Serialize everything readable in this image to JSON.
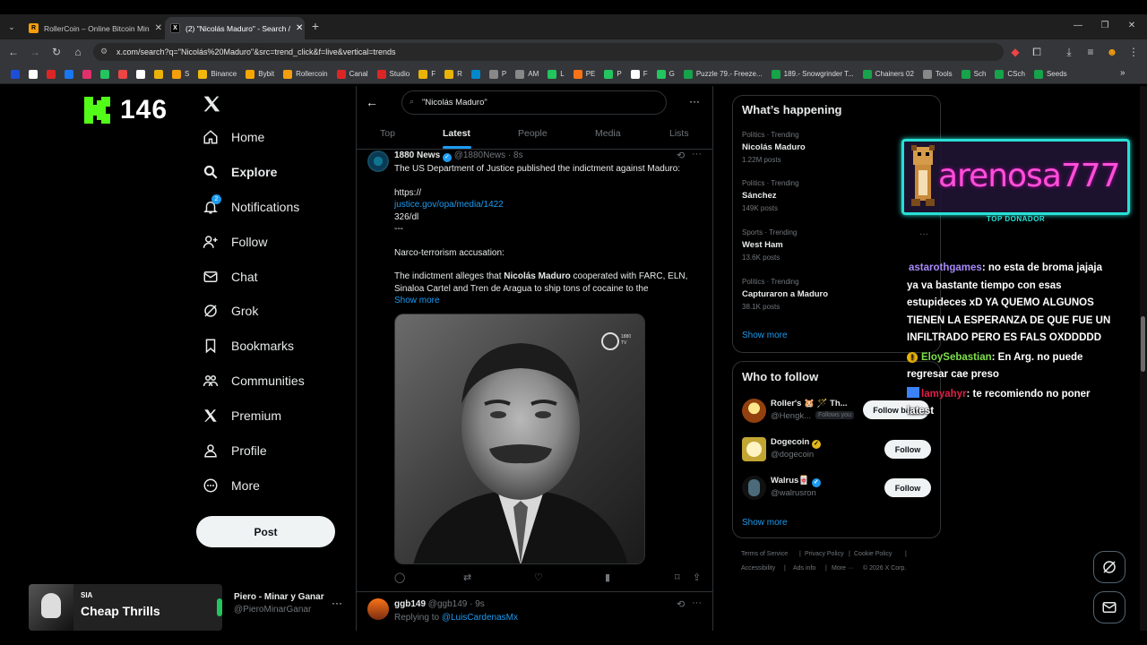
{
  "browser": {
    "tabs": [
      {
        "title": "RollerCoin – Online Bitcoin Min"
      },
      {
        "title": "(2) \"Nicolás Maduro\" - Search /"
      }
    ],
    "new_tab_symbol": "+",
    "url": "x.com/search?q=\"Nicolás%20Maduro\"&src=trend_click&f=live&vertical=trends",
    "bookmarks": [
      "",
      "",
      "",
      "",
      "",
      "",
      "",
      "",
      "",
      "S",
      "Binance",
      "Bybit",
      "Rollercoin",
      "Canal",
      "Studio",
      "F",
      "R",
      "",
      "P",
      "AM",
      "L",
      "PE",
      "P",
      "F",
      "G",
      "Puzzle 79.- Freeze...",
      "189.- Snowgrinder T...",
      "Chainers 02",
      "Tools",
      "Sch",
      "CSch",
      "Seeds"
    ]
  },
  "overlay": {
    "kick_count": "146",
    "donor_name": "arenosa777",
    "donor_label": "TOP DONADOR",
    "now_playing_artist": "SIA",
    "now_playing_title": "Cheap Thrills",
    "chat": [
      {
        "user": "astarothgames",
        "text": ": no esta de broma jajaja ya va bastante tiempo con esas estupideces xD YA QUEMO ALGUNOS TIENEN LA ESPERANZA DE QUE FUE UN INFILTRADO PERO ES FALS OXDDDDD",
        "color": "#a78bfa"
      },
      {
        "user": "EloySebastian",
        "text": ": En Arg. no puede regresar cae preso",
        "color": "#7ee04b"
      },
      {
        "user": "lamyahyr",
        "text": ": te recomiendo no poner latest",
        "color": "#e11d48"
      }
    ]
  },
  "nav": {
    "items": [
      {
        "label": "Home",
        "icon": "home-icon"
      },
      {
        "label": "Explore",
        "icon": "search-icon"
      },
      {
        "label": "Notifications",
        "icon": "bell-icon",
        "badge": "2"
      },
      {
        "label": "Follow",
        "icon": "person-add-icon"
      },
      {
        "label": "Chat",
        "icon": "mail-icon"
      },
      {
        "label": "Grok",
        "icon": "grok-icon"
      },
      {
        "label": "Bookmarks",
        "icon": "bookmark-icon"
      },
      {
        "label": "Communities",
        "icon": "people-icon"
      },
      {
        "label": "Premium",
        "icon": "x-logo-icon"
      },
      {
        "label": "Profile",
        "icon": "person-icon"
      },
      {
        "label": "More",
        "icon": "more-circle-icon"
      }
    ],
    "post_label": "Post",
    "account_name": "Piero - Minar y Ganar",
    "account_handle": "@PieroMinarGanar"
  },
  "search": {
    "query": "\"Nicolás Maduro\"",
    "tabs": [
      "Top",
      "Latest",
      "People",
      "Media",
      "Lists"
    ],
    "active_tab": "Latest"
  },
  "tweet1": {
    "name": "1880 News",
    "handle": "@1880News",
    "time": "· 8s",
    "line1": "The US Department of Justice published the indictment against Maduro:",
    "url_prefix": "https://",
    "url_link": "justice.gov/opa/media/1422",
    "url_suffix": "326/dl",
    "dash": "---",
    "line_accusation": "Narco-terrorism accusation:",
    "body_a": "The indictment alleges that ",
    "body_bold": "Nicolás Maduro",
    "body_b": " cooperated with FARC, ELN,",
    "body_c": "Sinaloa Cartel and Tren de Aragua to ship tons of cocaine to the",
    "show_more": "Show more",
    "watermark": "1880 TV"
  },
  "tweet2": {
    "name": "ggb149",
    "handle": "@ggb149",
    "time": "· 9s",
    "replying_prefix": "Replying to ",
    "replying_to": "@LuisCardenasMx"
  },
  "trending": {
    "title": "What’s happening",
    "items": [
      {
        "meta": "Politics · Trending",
        "name": "Nicolás Maduro",
        "count": "1.22M posts"
      },
      {
        "meta": "Politics · Trending",
        "name": "Sánchez",
        "count": "149K posts"
      },
      {
        "meta": "Sports · Trending",
        "name": "West Ham",
        "count": "13.6K posts"
      },
      {
        "meta": "Politics · Trending",
        "name": "Capturaron a Maduro",
        "count": "38.1K posts"
      }
    ],
    "show_more": "Show more"
  },
  "who_to_follow": {
    "title": "Who to follow",
    "users": [
      {
        "name": "Roller's 🐹 🪄 Th...",
        "handle": "@Hengk...",
        "follows_you": "Follows you",
        "button": "Follow back"
      },
      {
        "name": "Dogecoin",
        "handle": "@dogecoin",
        "button": "Follow"
      },
      {
        "name": "Walrus🀄",
        "handle": "@walrusron",
        "button": "Follow"
      }
    ],
    "show_more": "Show more"
  },
  "footer": {
    "links": [
      "Terms of Service",
      "|",
      "Privacy Policy",
      "|",
      "Cookie Policy",
      "|",
      "Accessibility",
      "|",
      "Ads info",
      "|",
      "More ···",
      "© 2026 X Corp."
    ]
  },
  "colors": {
    "accent": "#1d9bf0",
    "background": "#000000",
    "kick_green": "#53fc18",
    "donor_pink": "#ff4fd8",
    "donor_cyan": "#27e0d6"
  }
}
